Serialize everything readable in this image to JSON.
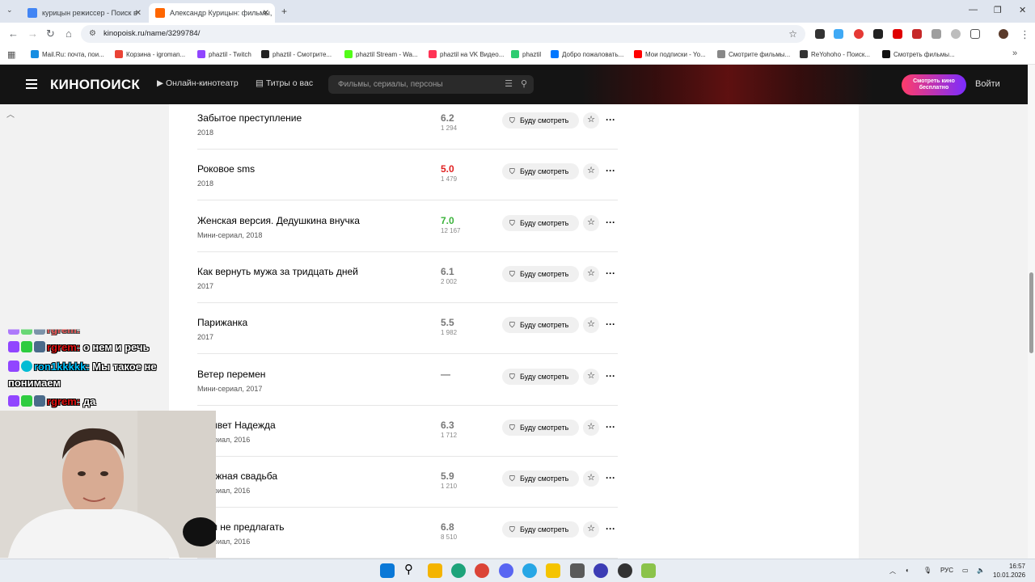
{
  "browser": {
    "tabs": [
      {
        "title": "курицын режиссер - Поиск в",
        "favicon_color": "#4285f4",
        "active": false
      },
      {
        "title": "Александр Курицын: фильмы,",
        "favicon_color": "#ff6600",
        "active": true
      }
    ],
    "new_tab": "+",
    "url": "kinopoisk.ru/name/3299784/",
    "bookmarks": [
      {
        "label": "Mail.Ru: почта, пои...",
        "color": "#168de2"
      },
      {
        "label": "Корзина - igroman...",
        "color": "#ea4335"
      },
      {
        "label": "phaztil - Twitch",
        "color": "#9146ff"
      },
      {
        "label": "phaztil - Смотрите...",
        "color": "#222222"
      },
      {
        "label": "phaztil Stream - Wa...",
        "color": "#53fc18"
      },
      {
        "label": "phaztil на VK Видео...",
        "color": "#ff3355"
      },
      {
        "label": "phaztil",
        "color": "#2ecc71"
      },
      {
        "label": "Добро пожаловать...",
        "color": "#0077ff"
      },
      {
        "label": "Мои подписки - Yo...",
        "color": "#ff0000"
      },
      {
        "label": "Смотрите фильмы...",
        "color": "#888888"
      },
      {
        "label": "ReYohoho - Поиск...",
        "color": "#333333"
      },
      {
        "label": "Смотреть фильмы...",
        "color": "#111111"
      }
    ]
  },
  "site": {
    "logo": "КИНОПОИСК",
    "nav_online": "Онлайн-кинотеатр",
    "nav_titles": "Титры о вас",
    "search_placeholder": "Фильмы, сериалы, персоны",
    "free_button": "Смотреть кино бесплатно",
    "login": "Войти"
  },
  "filmography": [
    {
      "title": "Забытое преступление",
      "meta": "2018",
      "rating": "6.2",
      "votes": "1 294",
      "rating_color": "#777777"
    },
    {
      "title": "Роковое sms",
      "meta": "2018",
      "rating": "5.0",
      "votes": "1 479",
      "rating_color": "#e02020"
    },
    {
      "title": "Женская версия. Дедушкина внучка",
      "meta": "Мини-сериал, 2018",
      "rating": "7.0",
      "votes": "12 167",
      "rating_color": "#3bb33b"
    },
    {
      "title": "Как вернуть мужа за тридцать дней",
      "meta": "2017",
      "rating": "6.1",
      "votes": "2 002",
      "rating_color": "#777777"
    },
    {
      "title": "Парижанка",
      "meta": "2017",
      "rating": "5.5",
      "votes": "1 982",
      "rating_color": "#777777"
    },
    {
      "title": "Ветер перемен",
      "meta": "Мини-сериал, 2017",
      "rating": "—",
      "votes": "",
      "rating_color": "#777777"
    },
    {
      "title": "...живет Надежда",
      "meta": "...-сериал, 2016",
      "rating": "6.3",
      "votes": "1 712",
      "rating_color": "#777777"
    },
    {
      "title": "...чужная свадьба",
      "meta": "...-сериал, 2016",
      "rating": "5.9",
      "votes": "1 210",
      "rating_color": "#777777"
    },
    {
      "title": "...им не предлагать",
      "meta": "...-сериал, 2016",
      "rating": "6.8",
      "votes": "8 510",
      "rating_color": "#777777"
    }
  ],
  "watch_label": "Буду смотреть",
  "chat": [
    {
      "user": "rgrem:",
      "text": "о нем и речь"
    },
    {
      "user": "ron1kkkkk:",
      "text": "Мы такое не"
    },
    {
      "user": "",
      "text": "понимаем"
    },
    {
      "user": "rgrem:",
      "text": "да"
    }
  ],
  "taskbar": {
    "lang": "РУС",
    "time": "16:57",
    "date": "10.01.2026"
  }
}
